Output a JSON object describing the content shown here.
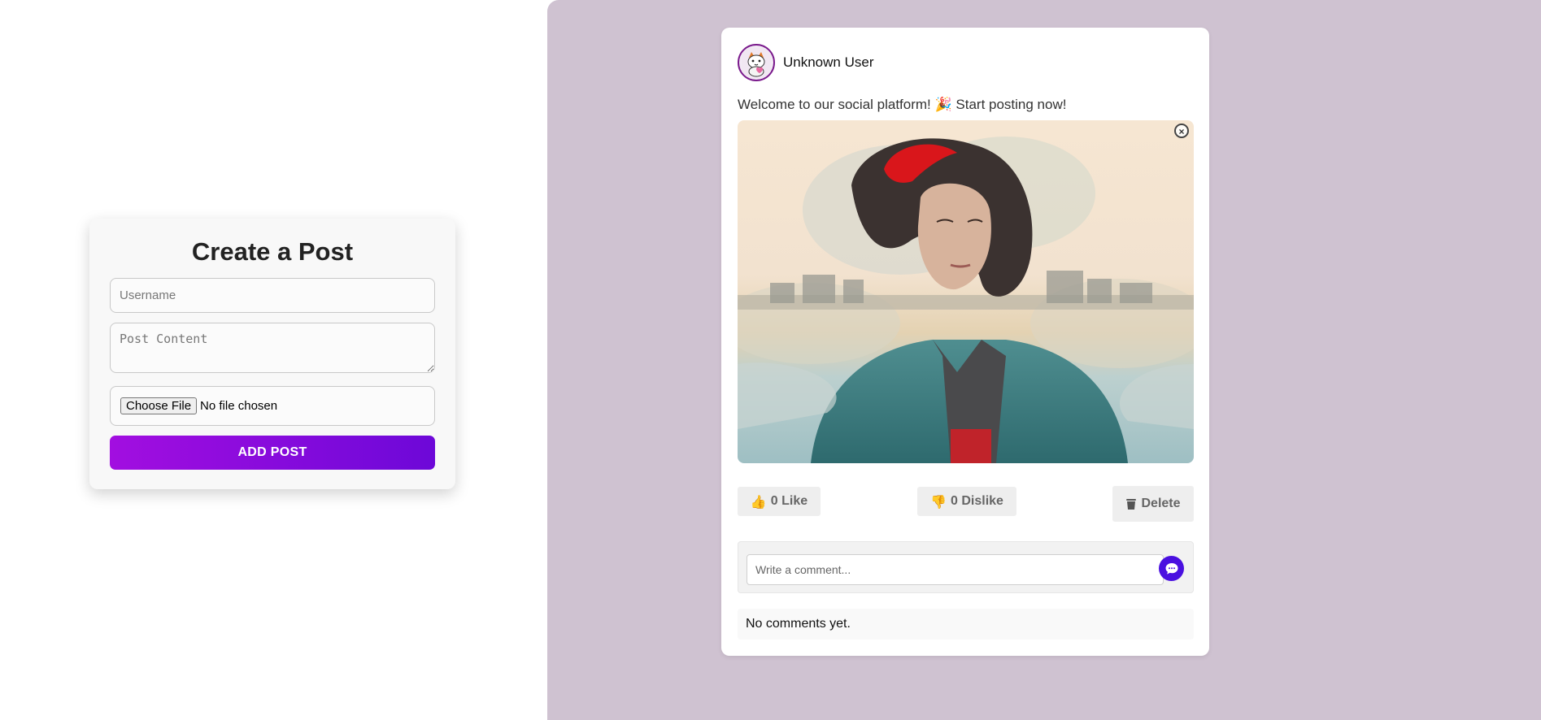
{
  "create_form": {
    "title": "Create a Post",
    "username_placeholder": "Username",
    "content_placeholder": "Post Content",
    "file_button_label": "Choose File",
    "file_status": "No file chosen",
    "submit_label": "ADD POST"
  },
  "post": {
    "author": "Unknown User",
    "text": "Welcome to our social platform! 🎉 Start posting now!",
    "close_label": "×",
    "like_count": "0",
    "like_label": "Like",
    "dislike_count": "0",
    "dislike_label": "Dislike",
    "delete_label": "Delete",
    "comment_placeholder": "Write a comment...",
    "no_comments_text": "No comments yet."
  },
  "icons": {
    "like": "thumbs-up-icon",
    "dislike": "thumbs-down-icon",
    "delete": "trash-icon",
    "send": "chat-bubble-icon"
  },
  "colors": {
    "accent_start": "#a20ee0",
    "accent_end": "#6d08d8",
    "right_background": "#cfc2d1",
    "send_button": "#4a10e0"
  }
}
